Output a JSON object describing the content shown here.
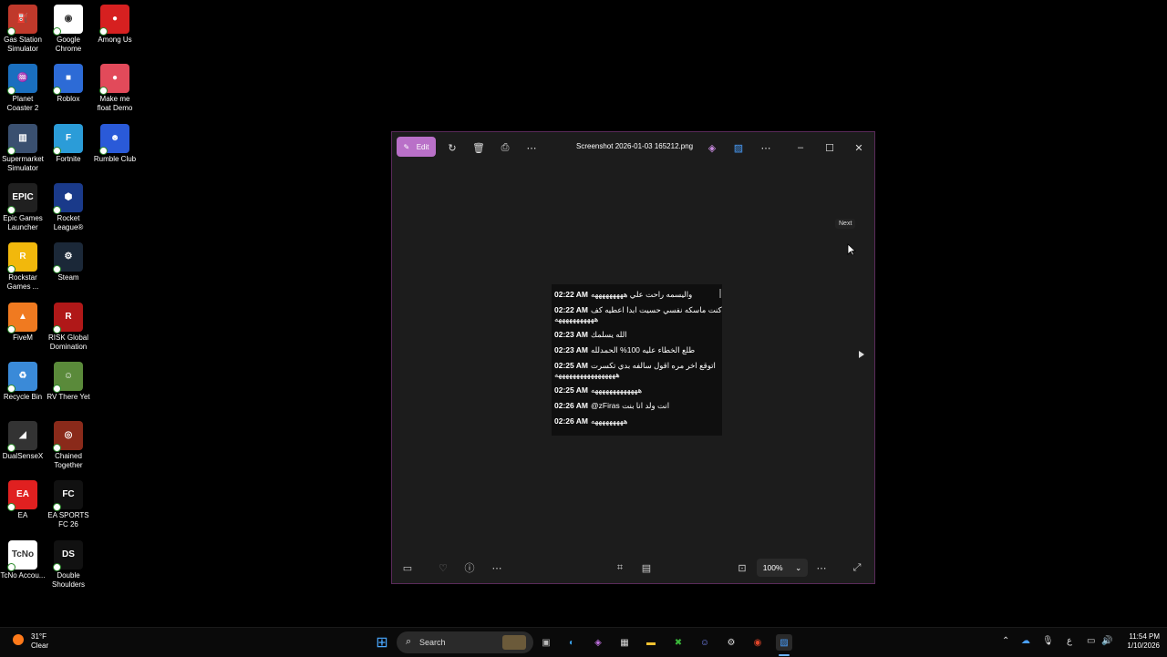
{
  "desktop": {
    "icons": [
      {
        "label": "Gas Station Simulator",
        "color": "#c0392b",
        "glyph": "⛽"
      },
      {
        "label": "Google Chrome",
        "color": "#ffffff",
        "glyph": "◉"
      },
      {
        "label": "Among Us",
        "color": "#d62020",
        "glyph": "●"
      },
      {
        "label": "Planet Coaster 2",
        "color": "#1a6fbf",
        "glyph": "♒"
      },
      {
        "label": "Roblox",
        "color": "#2d6bd6",
        "glyph": "■"
      },
      {
        "label": "Make me float Demo",
        "color": "#e24a5a",
        "glyph": "●"
      },
      {
        "label": "Supermarket Simulator",
        "color": "#3a5070",
        "glyph": "▥"
      },
      {
        "label": "Fortnite",
        "color": "#2b9cd8",
        "glyph": "F"
      },
      {
        "label": "Rumble Club",
        "color": "#2a5ad8",
        "glyph": "☻"
      },
      {
        "label": "Epic Games Launcher",
        "color": "#202020",
        "glyph": "EPIC"
      },
      {
        "label": "Rocket League®",
        "color": "#1a3a8a",
        "glyph": "⬢"
      },
      {
        "label": "Rockstar Games ...",
        "color": "#f2b80c",
        "glyph": "R"
      },
      {
        "label": "Steam",
        "color": "#1b2838",
        "glyph": "⚙"
      },
      {
        "label": "FiveM",
        "color": "#f07a20",
        "glyph": "▲"
      },
      {
        "label": "RISK Global Domination",
        "color": "#b01818",
        "glyph": "R"
      },
      {
        "label": "Recycle Bin",
        "color": "#3a8ad8",
        "glyph": "♻"
      },
      {
        "label": "RV There Yet",
        "color": "#5a8a3a",
        "glyph": "☺"
      },
      {
        "label": "DualSenseX",
        "color": "#333333",
        "glyph": "◢"
      },
      {
        "label": "Chained Together",
        "color": "#8a2a1a",
        "glyph": "◎"
      },
      {
        "label": "EA",
        "color": "#e02020",
        "glyph": "EA"
      },
      {
        "label": "EA SPORTS FC 26",
        "color": "#111111",
        "glyph": "FC"
      },
      {
        "label": "TcNo Accou...",
        "color": "#ffffff",
        "glyph": "TcNo"
      },
      {
        "label": "Double Shoulders",
        "color": "#111111",
        "glyph": "DS"
      }
    ]
  },
  "viewer": {
    "edit_label": "Edit",
    "filename": "Screenshot 2026-01-03 165212.png",
    "next_tooltip": "Next",
    "zoom": "100%",
    "messages": [
      {
        "time": "02:22 AM",
        "text": "واليسمه راحت علي هههههههههه"
      },
      {
        "time": "02:22 AM",
        "text": "كنت ماسكه نفسي حسيت ابدا اعطيه كف"
      },
      {
        "time": "",
        "text": "هههههههههههه"
      },
      {
        "time": "02:23 AM",
        "text": "الله يسلمك"
      },
      {
        "time": "02:23 AM",
        "text": "طلع الخطاء عليه 100% الحمدلله"
      },
      {
        "time": "02:25 AM",
        "text": "اتوقع اخر مره اقول سالفه بدي تكسرت"
      },
      {
        "time": "",
        "text": "هههههههههههههههههه"
      },
      {
        "time": "02:25 AM",
        "text": "هههههههههههههه"
      },
      {
        "time": "02:26 AM",
        "text": "@zFiras انت ولد انا بنت"
      },
      {
        "time": "02:26 AM",
        "text": "هههههههههه"
      }
    ]
  },
  "taskbar": {
    "weather_temp": "31°F",
    "weather_desc": "Clear",
    "search_label": "Search",
    "time": "11:54 PM",
    "date": "1/10/2026",
    "lang": "ع"
  }
}
